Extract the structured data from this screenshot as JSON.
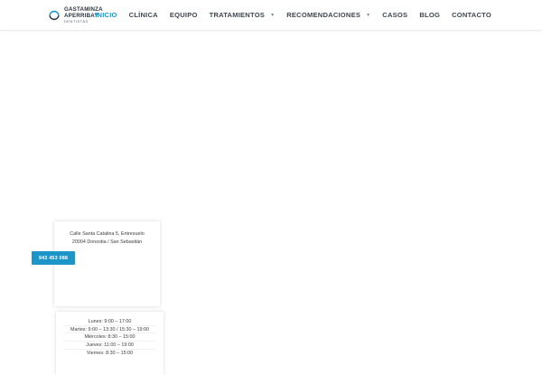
{
  "logo": {
    "line1": "GASTAMINZA",
    "line2": "APERRIBAY",
    "line3": "DENTISTAS",
    "icon": "logo-ring-icon"
  },
  "nav": {
    "items": [
      {
        "label": "INICIO",
        "active": true
      },
      {
        "label": "CLÍNICA"
      },
      {
        "label": "EQUIPO"
      },
      {
        "label": "TRATAMIENTOS",
        "has_dropdown": true
      },
      {
        "label": "RECOMENDACIONES",
        "has_dropdown": true
      },
      {
        "label": "CASOS"
      },
      {
        "label": "BLOG"
      },
      {
        "label": "CONTACTO"
      }
    ],
    "dropdown_icon": "▼"
  },
  "address_card": {
    "line1": "Calle Santa Catalina 5, Entresuelo",
    "line2": "20004 Donostia / San Sebastián",
    "phone": "943 453 088"
  },
  "hours_card": {
    "rows": [
      "Lunes: 9:00 – 17:00",
      "Martes: 9:00 – 13:30 / 15:30 – 19:00",
      "Miércoles: 8:30 – 15:00",
      "Jueves: 11:00 – 19:00",
      "Viernes: 8:30 – 15:00"
    ]
  },
  "colors": {
    "accent": "#1e95c9",
    "nav_text": "#3f4750",
    "logo_text": "#2b3440"
  }
}
